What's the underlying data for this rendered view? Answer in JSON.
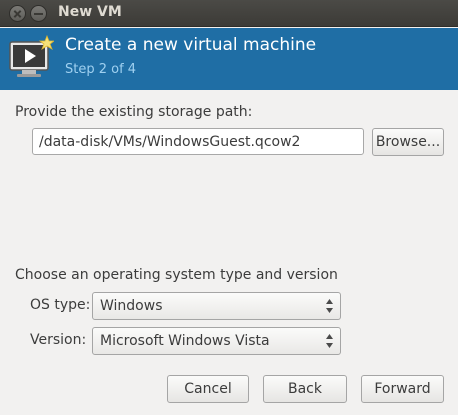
{
  "window": {
    "title": "New VM"
  },
  "header": {
    "title": "Create a new virtual machine",
    "step": "Step 2 of 4",
    "icon": "vm-screen-icon"
  },
  "storage": {
    "label": "Provide the existing storage path:",
    "path_value": "/data-disk/VMs/WindowsGuest.qcow2",
    "browse_label": "Browse..."
  },
  "os": {
    "section_label": "Choose an operating system type and version",
    "type_label": "OS type:",
    "type_value": "Windows",
    "version_label": "Version:",
    "version_value": "Microsoft Windows Vista"
  },
  "buttons": {
    "cancel": "Cancel",
    "back": "Back",
    "forward": "Forward"
  },
  "colors": {
    "header_bg": "#1f6ea5",
    "step_text": "#9fd0f0"
  }
}
